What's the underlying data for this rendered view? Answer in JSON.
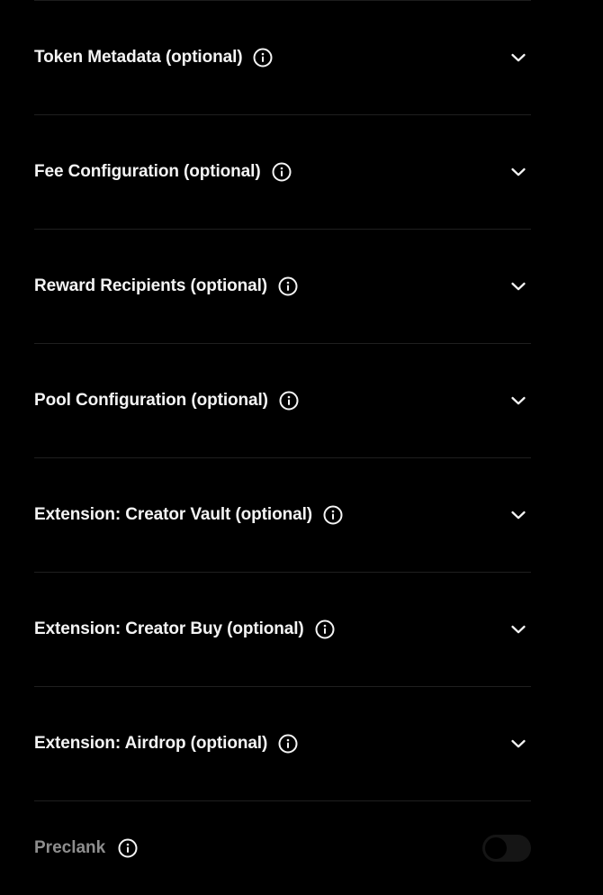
{
  "sections": [
    {
      "title": "Token Metadata (optional)",
      "expanded": false
    },
    {
      "title": "Fee Configuration (optional)",
      "expanded": false
    },
    {
      "title": "Reward Recipients (optional)",
      "expanded": false
    },
    {
      "title": "Pool Configuration (optional)",
      "expanded": false
    },
    {
      "title": "Extension: Creator Vault (optional)",
      "expanded": false
    },
    {
      "title": "Extension: Creator Buy (optional)",
      "expanded": false
    },
    {
      "title": "Extension: Airdrop (optional)",
      "expanded": false
    }
  ],
  "preclank": {
    "label": "Preclank",
    "enabled": false
  },
  "icons": {
    "info": "info-circle-icon",
    "expand": "chevron-down-icon"
  },
  "colors": {
    "background": "#000000",
    "text": "#f4f4f4",
    "muted_text": "#8e8e8e",
    "divider": "#1f1f1f",
    "toggle_track": "#151515"
  }
}
